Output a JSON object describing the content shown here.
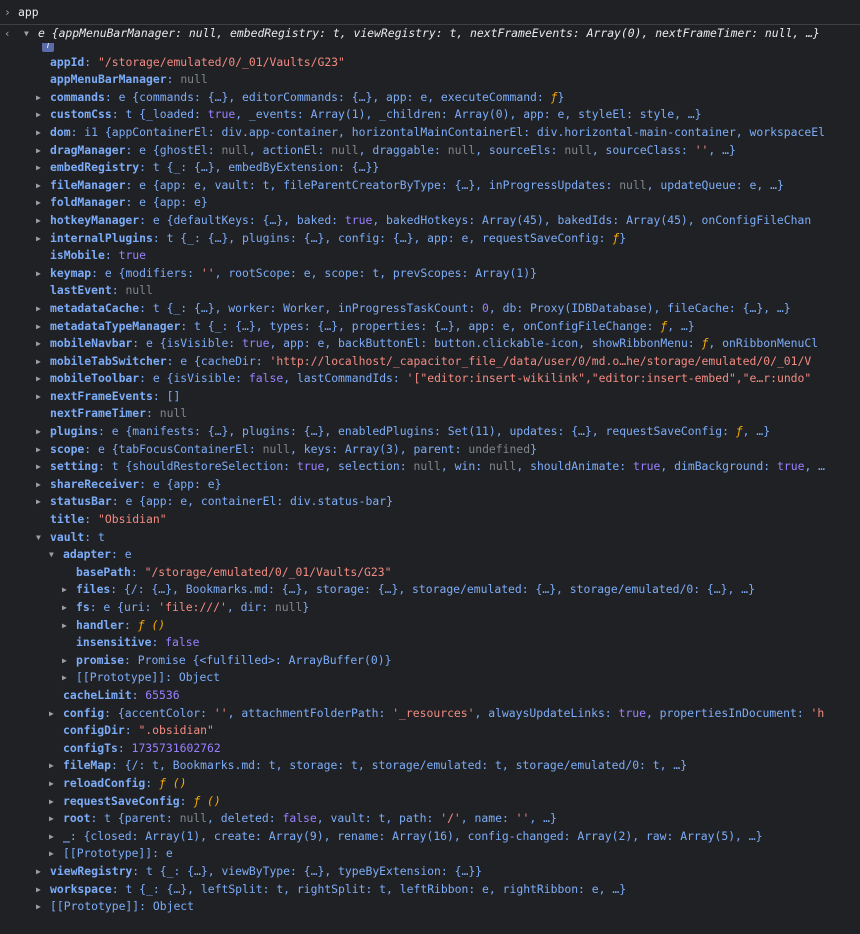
{
  "console": {
    "input_prompt": "›",
    "input_text": "app",
    "result_arrow": "‹",
    "info_badge": "i",
    "lines": [
      {
        "indent": 0,
        "toggle": "expanded",
        "segments": [
          [
            "prev",
            "e {appMenuBarManager: null, embedRegistry: t, viewRegistry: t, nextFrameEvents: Array(0), nextFrameTimer: null, …}"
          ]
        ]
      },
      {
        "indent": 1,
        "toggle": "",
        "segments": [
          [
            "key",
            "appId"
          ],
          [
            "p",
            ": "
          ],
          [
            "str",
            "\"/storage/emulated/0/_01/Vaults/G23\""
          ]
        ]
      },
      {
        "indent": 1,
        "toggle": "",
        "segments": [
          [
            "key",
            "appMenuBarManager"
          ],
          [
            "p",
            ": "
          ],
          [
            "null",
            "null"
          ]
        ]
      },
      {
        "indent": 1,
        "toggle": "collapsed",
        "segments": [
          [
            "key",
            "commands"
          ],
          [
            "p",
            ": e {commands: {…}, editorCommands: {…}, app: e, executeCommand: "
          ],
          [
            "fn",
            "ƒ"
          ],
          [
            "p",
            "}"
          ]
        ]
      },
      {
        "indent": 1,
        "toggle": "collapsed",
        "segments": [
          [
            "key",
            "customCss"
          ],
          [
            "p",
            ": t {_loaded: "
          ],
          [
            "bool",
            "true"
          ],
          [
            "p",
            ", _events: Array(1), _children: Array(0), app: e, styleEl: style, …}"
          ]
        ]
      },
      {
        "indent": 1,
        "toggle": "collapsed",
        "segments": [
          [
            "key",
            "dom"
          ],
          [
            "p",
            ": i1 {appContainerEl: "
          ],
          [
            "el",
            "div.app-container"
          ],
          [
            "p",
            ", horizontalMainContainerEl: "
          ],
          [
            "el",
            "div.horizontal-main-container"
          ],
          [
            "p",
            ", workspaceEl"
          ]
        ]
      },
      {
        "indent": 1,
        "toggle": "collapsed",
        "segments": [
          [
            "key",
            "dragManager"
          ],
          [
            "p",
            ": e {ghostEl: "
          ],
          [
            "null",
            "null"
          ],
          [
            "p",
            ", actionEl: "
          ],
          [
            "null",
            "null"
          ],
          [
            "p",
            ", draggable: "
          ],
          [
            "null",
            "null"
          ],
          [
            "p",
            ", sourceEls: "
          ],
          [
            "null",
            "null"
          ],
          [
            "p",
            ", sourceClass: "
          ],
          [
            "str",
            "''"
          ],
          [
            "p",
            ", …}"
          ]
        ]
      },
      {
        "indent": 1,
        "toggle": "collapsed",
        "segments": [
          [
            "key",
            "embedRegistry"
          ],
          [
            "p",
            ": t {_: {…}, embedByExtension: {…}}"
          ]
        ]
      },
      {
        "indent": 1,
        "toggle": "collapsed",
        "segments": [
          [
            "key",
            "fileManager"
          ],
          [
            "p",
            ": e {app: e, vault: t, fileParentCreatorByType: {…}, inProgressUpdates: "
          ],
          [
            "null",
            "null"
          ],
          [
            "p",
            ", updateQueue: e, …}"
          ]
        ]
      },
      {
        "indent": 1,
        "toggle": "collapsed",
        "segments": [
          [
            "key",
            "foldManager"
          ],
          [
            "p",
            ": e {app: e}"
          ]
        ]
      },
      {
        "indent": 1,
        "toggle": "collapsed",
        "segments": [
          [
            "key",
            "hotkeyManager"
          ],
          [
            "p",
            ": e {defaultKeys: {…}, baked: "
          ],
          [
            "bool",
            "true"
          ],
          [
            "p",
            ", bakedHotkeys: Array(45), bakedIds: Array(45), onConfigFileChan"
          ]
        ]
      },
      {
        "indent": 1,
        "toggle": "collapsed",
        "segments": [
          [
            "key",
            "internalPlugins"
          ],
          [
            "p",
            ": t {_: {…}, plugins: {…}, config: {…}, app: e, requestSaveConfig: "
          ],
          [
            "fn",
            "ƒ"
          ],
          [
            "p",
            "}"
          ]
        ]
      },
      {
        "indent": 1,
        "toggle": "",
        "segments": [
          [
            "key",
            "isMobile"
          ],
          [
            "p",
            ": "
          ],
          [
            "bool",
            "true"
          ]
        ]
      },
      {
        "indent": 1,
        "toggle": "collapsed",
        "segments": [
          [
            "key",
            "keymap"
          ],
          [
            "p",
            ": e {modifiers: "
          ],
          [
            "str",
            "''"
          ],
          [
            "p",
            ", rootScope: e, scope: t, prevScopes: Array(1)}"
          ]
        ]
      },
      {
        "indent": 1,
        "toggle": "",
        "segments": [
          [
            "key",
            "lastEvent"
          ],
          [
            "p",
            ": "
          ],
          [
            "null",
            "null"
          ]
        ]
      },
      {
        "indent": 1,
        "toggle": "collapsed",
        "segments": [
          [
            "key",
            "metadataCache"
          ],
          [
            "p",
            ": t {_: {…}, worker: Worker, inProgressTaskCount: "
          ],
          [
            "num",
            "0"
          ],
          [
            "p",
            ", db: Proxy(IDBDatabase), fileCache: {…}, …}"
          ]
        ]
      },
      {
        "indent": 1,
        "toggle": "collapsed",
        "segments": [
          [
            "key",
            "metadataTypeManager"
          ],
          [
            "p",
            ": t {_: {…}, types: {…}, properties: {…}, app: e, onConfigFileChange: "
          ],
          [
            "fn",
            "ƒ"
          ],
          [
            "p",
            ", …}"
          ]
        ]
      },
      {
        "indent": 1,
        "toggle": "collapsed",
        "segments": [
          [
            "key",
            "mobileNavbar"
          ],
          [
            "p",
            ": e {isVisible: "
          ],
          [
            "bool",
            "true"
          ],
          [
            "p",
            ", app: e, backButtonEl: "
          ],
          [
            "el",
            "button.clickable-icon"
          ],
          [
            "p",
            ", showRibbonMenu: "
          ],
          [
            "fn",
            "ƒ"
          ],
          [
            "p",
            ", onRibbonMenuCl"
          ]
        ]
      },
      {
        "indent": 1,
        "toggle": "collapsed",
        "segments": [
          [
            "key",
            "mobileTabSwitcher"
          ],
          [
            "p",
            ": e {cacheDir: "
          ],
          [
            "str",
            "'http://localhost/_capacitor_file_/data/user/0/md.o…he/storage/emulated/0/_01/V"
          ]
        ]
      },
      {
        "indent": 1,
        "toggle": "collapsed",
        "segments": [
          [
            "key",
            "mobileToolbar"
          ],
          [
            "p",
            ": e {isVisible: "
          ],
          [
            "bool",
            "false"
          ],
          [
            "p",
            ", lastCommandIds: "
          ],
          [
            "str",
            "'[\"editor:insert-wikilink\",\"editor:insert-embed\",\"e…r:undo\""
          ]
        ]
      },
      {
        "indent": 1,
        "toggle": "collapsed",
        "segments": [
          [
            "key",
            "nextFrameEvents"
          ],
          [
            "p",
            ": []"
          ]
        ]
      },
      {
        "indent": 1,
        "toggle": "",
        "segments": [
          [
            "key",
            "nextFrameTimer"
          ],
          [
            "p",
            ": "
          ],
          [
            "null",
            "null"
          ]
        ]
      },
      {
        "indent": 1,
        "toggle": "collapsed",
        "segments": [
          [
            "key",
            "plugins"
          ],
          [
            "p",
            ": e {manifests: {…}, plugins: {…}, enabledPlugins: Set(11), updates: {…}, requestSaveConfig: "
          ],
          [
            "fn",
            "ƒ"
          ],
          [
            "p",
            ", …}"
          ]
        ]
      },
      {
        "indent": 1,
        "toggle": "collapsed",
        "segments": [
          [
            "key",
            "scope"
          ],
          [
            "p",
            ": e {tabFocusContainerEl: "
          ],
          [
            "null",
            "null"
          ],
          [
            "p",
            ", keys: Array(3), parent: "
          ],
          [
            "null",
            "undefined"
          ],
          [
            "p",
            "}"
          ]
        ]
      },
      {
        "indent": 1,
        "toggle": "collapsed",
        "segments": [
          [
            "key",
            "setting"
          ],
          [
            "p",
            ": t {shouldRestoreSelection: "
          ],
          [
            "bool",
            "true"
          ],
          [
            "p",
            ", selection: "
          ],
          [
            "null",
            "null"
          ],
          [
            "p",
            ", win: "
          ],
          [
            "null",
            "null"
          ],
          [
            "p",
            ", shouldAnimate: "
          ],
          [
            "bool",
            "true"
          ],
          [
            "p",
            ", dimBackground: "
          ],
          [
            "bool",
            "true"
          ],
          [
            "p",
            ", …"
          ]
        ]
      },
      {
        "indent": 1,
        "toggle": "collapsed",
        "segments": [
          [
            "key",
            "shareReceiver"
          ],
          [
            "p",
            ": e {app: e}"
          ]
        ]
      },
      {
        "indent": 1,
        "toggle": "collapsed",
        "segments": [
          [
            "key",
            "statusBar"
          ],
          [
            "p",
            ": e {app: e, containerEl: "
          ],
          [
            "el",
            "div.status-bar"
          ],
          [
            "p",
            "}"
          ]
        ]
      },
      {
        "indent": 1,
        "toggle": "",
        "segments": [
          [
            "key",
            "title"
          ],
          [
            "p",
            ": "
          ],
          [
            "str",
            "\"Obsidian\""
          ]
        ]
      },
      {
        "indent": 1,
        "toggle": "expanded",
        "segments": [
          [
            "key",
            "vault"
          ],
          [
            "p",
            ": t"
          ]
        ]
      },
      {
        "indent": 2,
        "toggle": "expanded",
        "segments": [
          [
            "key",
            "adapter"
          ],
          [
            "p",
            ": e"
          ]
        ]
      },
      {
        "indent": 3,
        "toggle": "",
        "segments": [
          [
            "key",
            "basePath"
          ],
          [
            "p",
            ": "
          ],
          [
            "str",
            "\"/storage/emulated/0/_01/Vaults/G23\""
          ]
        ]
      },
      {
        "indent": 3,
        "toggle": "collapsed",
        "segments": [
          [
            "key",
            "files"
          ],
          [
            "p",
            ": {/: {…}, Bookmarks.md: {…}, storage: {…}, storage/emulated: {…}, storage/emulated/0: {…}, …}"
          ]
        ]
      },
      {
        "indent": 3,
        "toggle": "collapsed",
        "segments": [
          [
            "key",
            "fs"
          ],
          [
            "p",
            ": e {uri: "
          ],
          [
            "str",
            "'file:///'"
          ],
          [
            "p",
            ", dir: "
          ],
          [
            "null",
            "null"
          ],
          [
            "p",
            "}"
          ]
        ]
      },
      {
        "indent": 3,
        "toggle": "collapsed",
        "segments": [
          [
            "key",
            "handler"
          ],
          [
            "p",
            ": "
          ],
          [
            "fn",
            "ƒ ()"
          ]
        ]
      },
      {
        "indent": 3,
        "toggle": "",
        "segments": [
          [
            "key",
            "insensitive"
          ],
          [
            "p",
            ": "
          ],
          [
            "bool",
            "false"
          ]
        ]
      },
      {
        "indent": 3,
        "toggle": "collapsed",
        "segments": [
          [
            "key",
            "promise"
          ],
          [
            "p",
            ": Promise {<fulfilled>: ArrayBuffer(0)}"
          ]
        ]
      },
      {
        "indent": 3,
        "toggle": "collapsed",
        "segments": [
          [
            "proto",
            "[[Prototype]]"
          ],
          [
            "p",
            ": Object"
          ]
        ]
      },
      {
        "indent": 2,
        "toggle": "",
        "segments": [
          [
            "key",
            "cacheLimit"
          ],
          [
            "p",
            ": "
          ],
          [
            "num",
            "65536"
          ]
        ]
      },
      {
        "indent": 2,
        "toggle": "collapsed",
        "segments": [
          [
            "key",
            "config"
          ],
          [
            "p",
            ": {accentColor: "
          ],
          [
            "str",
            "''"
          ],
          [
            "p",
            ", attachmentFolderPath: "
          ],
          [
            "str",
            "'_resources'"
          ],
          [
            "p",
            ", alwaysUpdateLinks: "
          ],
          [
            "bool",
            "true"
          ],
          [
            "p",
            ", propertiesInDocument: "
          ],
          [
            "str",
            "'h"
          ]
        ]
      },
      {
        "indent": 2,
        "toggle": "",
        "segments": [
          [
            "key",
            "configDir"
          ],
          [
            "p",
            ": "
          ],
          [
            "str",
            "\".obsidian\""
          ]
        ]
      },
      {
        "indent": 2,
        "toggle": "",
        "segments": [
          [
            "key",
            "configTs"
          ],
          [
            "p",
            ": "
          ],
          [
            "num",
            "1735731602762"
          ]
        ]
      },
      {
        "indent": 2,
        "toggle": "collapsed",
        "segments": [
          [
            "key",
            "fileMap"
          ],
          [
            "p",
            ": {/: t, Bookmarks.md: t, storage: t, storage/emulated: t, storage/emulated/0: t, …}"
          ]
        ]
      },
      {
        "indent": 2,
        "toggle": "collapsed",
        "segments": [
          [
            "key",
            "reloadConfig"
          ],
          [
            "p",
            ": "
          ],
          [
            "fn",
            "ƒ ()"
          ]
        ]
      },
      {
        "indent": 2,
        "toggle": "collapsed",
        "segments": [
          [
            "key",
            "requestSaveConfig"
          ],
          [
            "p",
            ": "
          ],
          [
            "fn",
            "ƒ ()"
          ]
        ]
      },
      {
        "indent": 2,
        "toggle": "collapsed",
        "segments": [
          [
            "key",
            "root"
          ],
          [
            "p",
            ": t {parent: "
          ],
          [
            "null",
            "null"
          ],
          [
            "p",
            ", deleted: "
          ],
          [
            "bool",
            "false"
          ],
          [
            "p",
            ", vault: t, path: "
          ],
          [
            "str",
            "'/'"
          ],
          [
            "p",
            ", name: "
          ],
          [
            "str",
            "''"
          ],
          [
            "p",
            ", …}"
          ]
        ]
      },
      {
        "indent": 2,
        "toggle": "collapsed",
        "segments": [
          [
            "key",
            "_"
          ],
          [
            "p",
            ": {closed: Array(1), create: Array(9), rename: Array(16), config-changed: Array(2), raw: Array(5), …}"
          ]
        ]
      },
      {
        "indent": 2,
        "toggle": "collapsed",
        "segments": [
          [
            "proto",
            "[[Prototype]]"
          ],
          [
            "p",
            ": e"
          ]
        ]
      },
      {
        "indent": 1,
        "toggle": "collapsed",
        "segments": [
          [
            "key",
            "viewRegistry"
          ],
          [
            "p",
            ": t {_: {…}, viewByType: {…}, typeByExtension: {…}}"
          ]
        ]
      },
      {
        "indent": 1,
        "toggle": "collapsed",
        "segments": [
          [
            "key",
            "workspace"
          ],
          [
            "p",
            ": t {_: {…}, leftSplit: t, rightSplit: t, leftRibbon: e, rightRibbon: e, …}"
          ]
        ]
      },
      {
        "indent": 1,
        "toggle": "collapsed",
        "segments": [
          [
            "proto",
            "[[Prototype]]"
          ],
          [
            "p",
            ": Object"
          ]
        ]
      }
    ]
  }
}
